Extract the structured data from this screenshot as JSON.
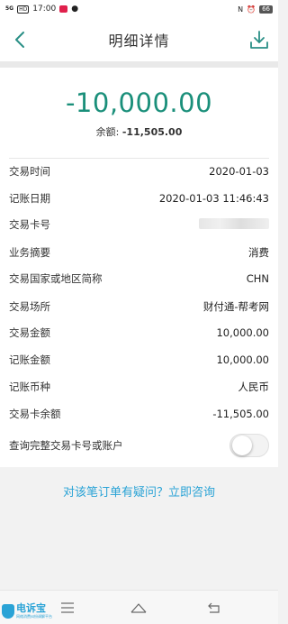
{
  "status_bar": {
    "signal": "5G",
    "hd": "HD",
    "time": "17:00",
    "battery": "66"
  },
  "header": {
    "title": "明细详情"
  },
  "transaction": {
    "amount": "-10,000.00",
    "balance_label": "余额:",
    "balance_value": "-11,505.00"
  },
  "details": [
    {
      "label": "交易时间",
      "value": "2020-01-03"
    },
    {
      "label": "记账日期",
      "value": "2020-01-03 11:46:43"
    },
    {
      "label": "交易卡号",
      "value": ""
    },
    {
      "label": "业务摘要",
      "value": "消费"
    },
    {
      "label": "交易国家或地区简称",
      "value": "CHN"
    },
    {
      "label": "交易场所",
      "value": "财付通-帮考网"
    },
    {
      "label": "交易金额",
      "value": "10,000.00"
    },
    {
      "label": "记账金额",
      "value": "10,000.00"
    },
    {
      "label": "记账币种",
      "value": "人民币"
    },
    {
      "label": "交易卡余额",
      "value": "-11,505.00"
    }
  ],
  "query_full_card": {
    "label": "查询完整交易卡号或账户",
    "enabled": false
  },
  "consult_link": "对该笔订单有疑问？立即咨询",
  "watermark": {
    "title": "电诉宝",
    "subtitle": "网络消费纠纷调解平台"
  },
  "colors": {
    "amount": "#1a8f7a",
    "link": "#2aa3d6",
    "header_icon": "#2a8f86"
  }
}
